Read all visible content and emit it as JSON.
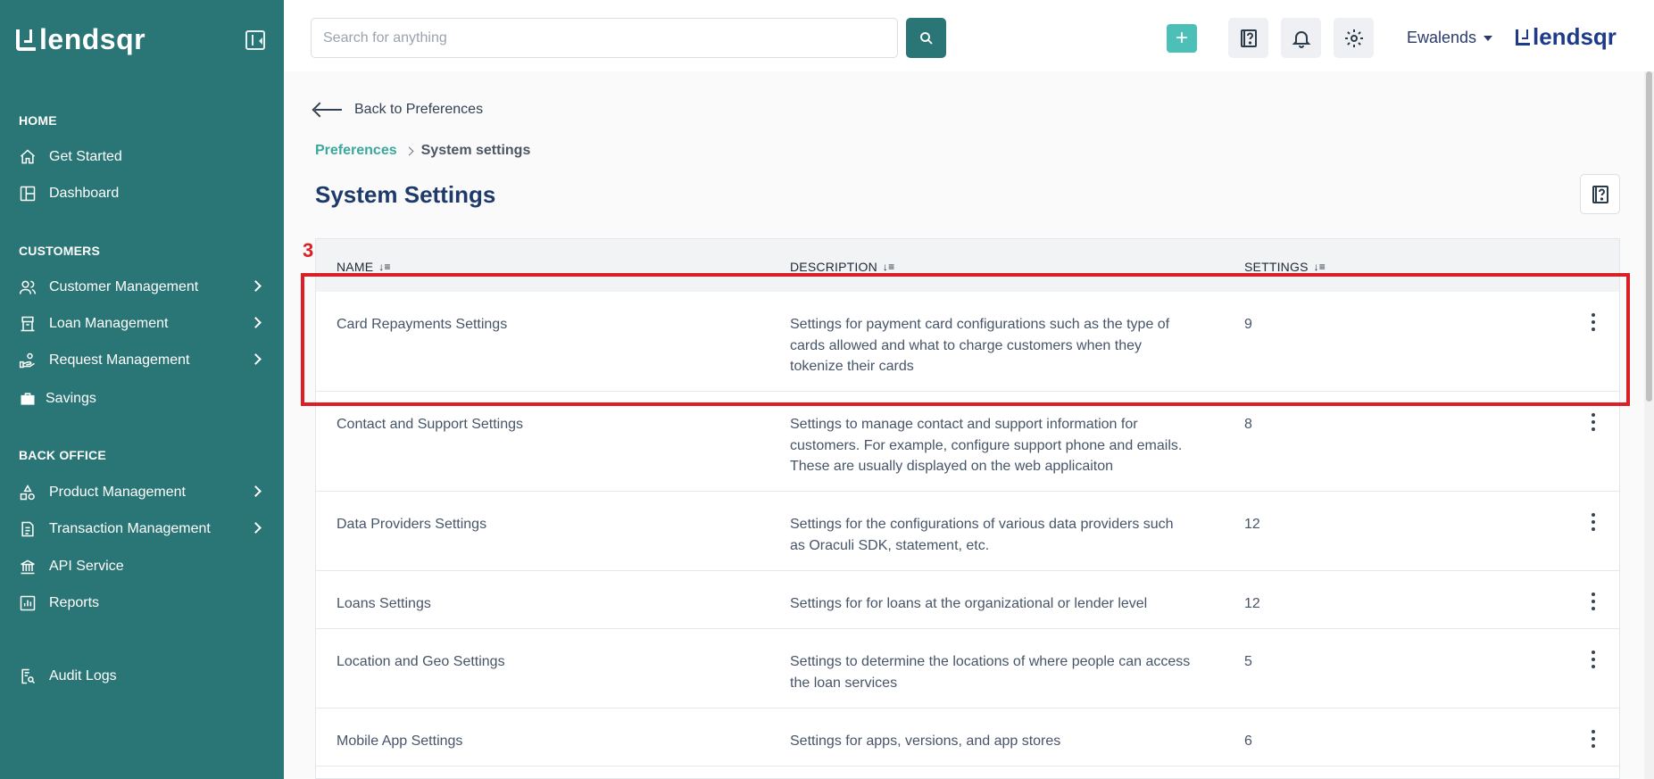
{
  "sidebar": {
    "brand": "lendsqr",
    "sections": [
      {
        "title": "HOME"
      },
      {
        "title": "CUSTOMERS"
      },
      {
        "title": "BACK OFFICE"
      }
    ],
    "items": [
      {
        "label": "Get Started",
        "icon": "home-icon"
      },
      {
        "label": "Dashboard",
        "icon": "dashboard-icon"
      },
      {
        "label": "Customer Management",
        "icon": "users-icon"
      },
      {
        "label": "Loan Management",
        "icon": "loan-icon"
      },
      {
        "label": "Request Management",
        "icon": "request-icon"
      },
      {
        "label": "Savings",
        "icon": "briefcase-icon"
      },
      {
        "label": "Product Management",
        "icon": "product-icon"
      },
      {
        "label": "Transaction Management",
        "icon": "transaction-icon"
      },
      {
        "label": "API Service",
        "icon": "bank-icon"
      },
      {
        "label": "Reports",
        "icon": "reports-icon"
      },
      {
        "label": "Audit Logs",
        "icon": "audit-icon"
      }
    ]
  },
  "topbar": {
    "search_placeholder": "Search for anything",
    "add_label": "+",
    "user_name": "Ewalends",
    "brand": "lendsqr"
  },
  "page": {
    "back_label": "Back to Preferences",
    "breadcrumb": {
      "parent": "Preferences",
      "current": "System settings"
    },
    "title": "System Settings"
  },
  "table": {
    "headers": {
      "name": "NAME",
      "description": "DESCRIPTION",
      "settings": "SETTINGS"
    },
    "rows": [
      {
        "name": "Card Repayments Settings",
        "description": "Settings for payment card configurations such as the type of cards allowed and what to charge customers when they tokenize their cards",
        "count": "9"
      },
      {
        "name": "Contact and Support Settings",
        "description": "Settings to manage contact and support information for customers. For example, configure support phone and emails. These are usually displayed on the web applicaiton",
        "count": "8"
      },
      {
        "name": "Data Providers Settings",
        "description": "Settings for the configurations of various data providers such as Oraculi SDK, statement, etc.",
        "count": "12"
      },
      {
        "name": "Loans Settings",
        "description": "Settings for for loans at the organizational or lender level",
        "count": "12"
      },
      {
        "name": "Location and Geo Settings",
        "description": "Settings to determine the locations of where people can access the loan services",
        "count": "5"
      },
      {
        "name": "Mobile App Settings",
        "description": "Settings for apps, versions, and app stores",
        "count": "6"
      }
    ]
  },
  "annotation": {
    "number": "3",
    "color": "#dc1f26"
  },
  "colors": {
    "sidebar": "#2a7575",
    "accent": "#39a89d",
    "title": "#1e3a6b",
    "add_button": "#4cc0b6"
  }
}
